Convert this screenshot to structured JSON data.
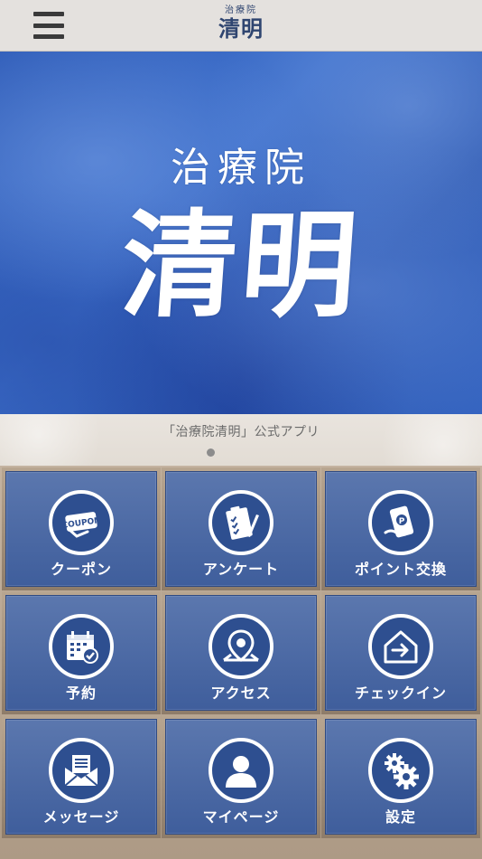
{
  "header": {
    "menu_icon": "hamburger-menu-icon",
    "logo_small": "治療院",
    "logo_big": "清明"
  },
  "hero": {
    "subtitle": "治療院",
    "title": "清明"
  },
  "caption": {
    "text": "「治療院清明」公式アプリ"
  },
  "menu": {
    "items": [
      {
        "label": "クーポン",
        "icon": "coupon-icon"
      },
      {
        "label": "アンケート",
        "icon": "clipboard-survey-icon"
      },
      {
        "label": "ポイント交換",
        "icon": "phone-points-icon"
      },
      {
        "label": "予約",
        "icon": "calendar-check-icon"
      },
      {
        "label": "アクセス",
        "icon": "map-pin-icon"
      },
      {
        "label": "チェックイン",
        "icon": "check-in-house-icon"
      },
      {
        "label": "メッセージ",
        "icon": "envelope-message-icon"
      },
      {
        "label": "マイページ",
        "icon": "user-profile-icon"
      },
      {
        "label": "設定",
        "icon": "gears-settings-icon"
      }
    ]
  },
  "colors": {
    "tile_blue": "#4a68a6",
    "icon_circle": "#2e4f90",
    "header_bg": "#e4e1de",
    "frame": "#a8957f"
  }
}
